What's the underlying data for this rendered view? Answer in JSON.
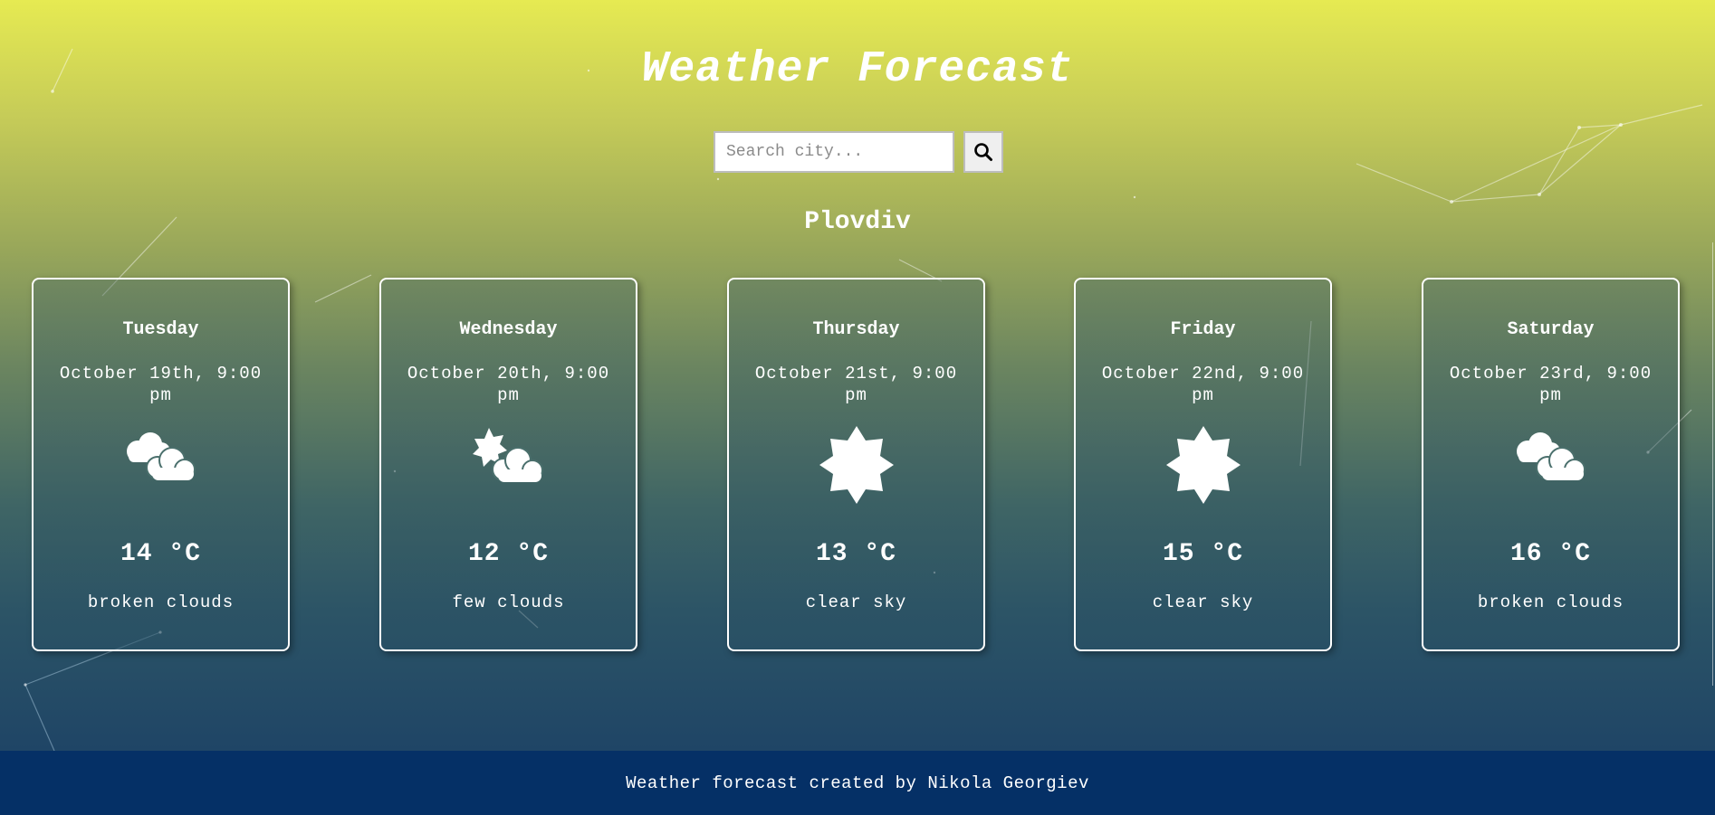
{
  "header": {
    "title": "Weather Forecast"
  },
  "search": {
    "placeholder": "Search city...",
    "value": "",
    "button_icon": "search-icon"
  },
  "location": {
    "city": "Plovdiv"
  },
  "forecast": [
    {
      "day": "Tuesday",
      "date": "October 19th, 9:00 pm",
      "icon": "broken-clouds-icon",
      "temp": "14 °C",
      "description": "broken clouds"
    },
    {
      "day": "Wednesday",
      "date": "October 20th, 9:00 pm",
      "icon": "few-clouds-icon",
      "temp": "12 °C",
      "description": "few clouds"
    },
    {
      "day": "Thursday",
      "date": "October 21st, 9:00 pm",
      "icon": "clear-sky-icon",
      "temp": "13 °C",
      "description": "clear sky"
    },
    {
      "day": "Friday",
      "date": "October 22nd, 9:00 pm",
      "icon": "clear-sky-icon",
      "temp": "15 °C",
      "description": "clear sky"
    },
    {
      "day": "Saturday",
      "date": "October 23rd, 9:00 pm",
      "icon": "broken-clouds-icon",
      "temp": "16 °C",
      "description": "broken clouds"
    }
  ],
  "footer": {
    "text": "Weather forecast created by Nikola Georgiev"
  },
  "colors": {
    "gradient_top": "#e6ea52",
    "gradient_bottom": "#1f4566",
    "footer_bg": "#053066",
    "text": "#ffffff"
  }
}
